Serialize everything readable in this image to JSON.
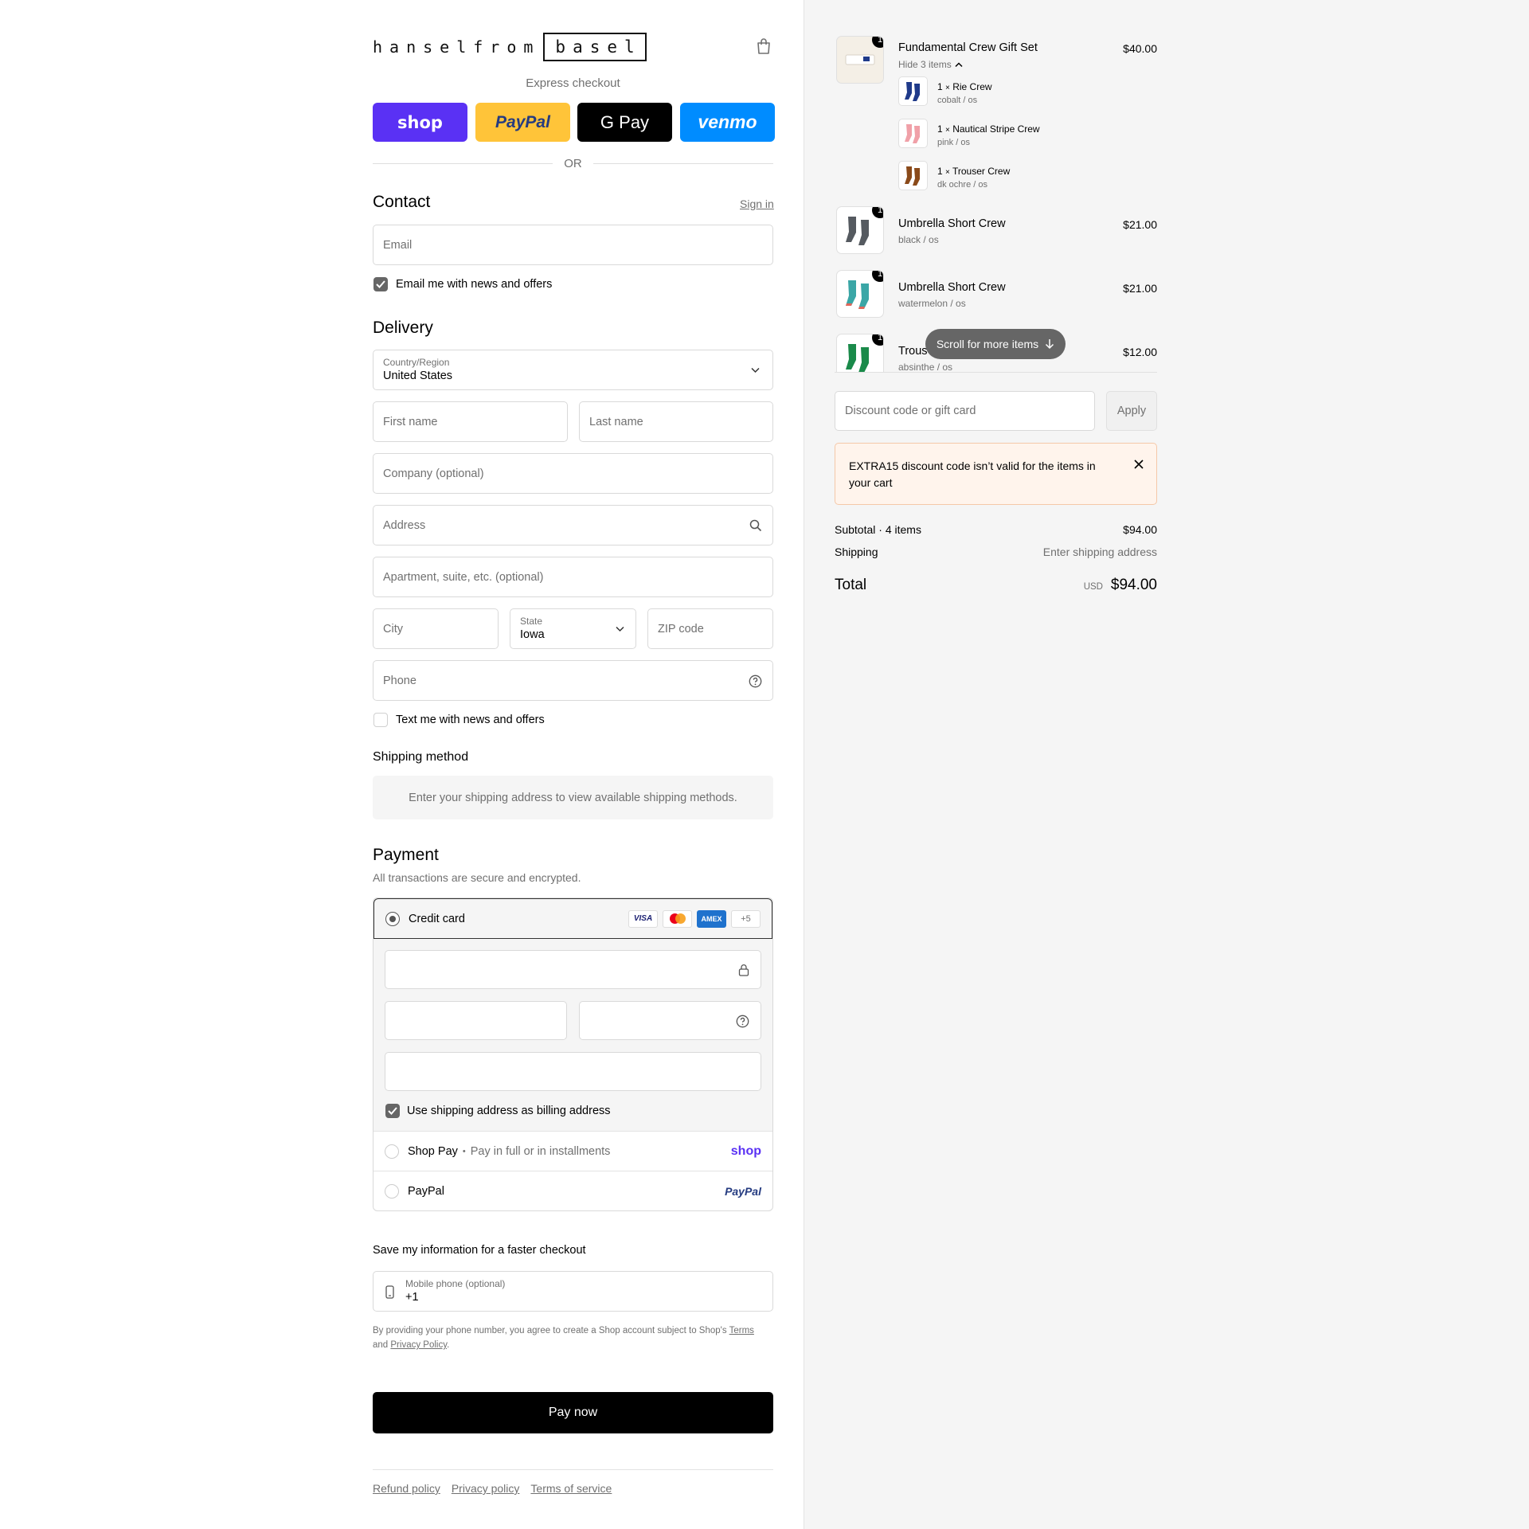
{
  "brand": {
    "word1": "hanselfrom",
    "word2": "basel"
  },
  "express": {
    "title": "Express checkout",
    "buttons": [
      {
        "label": "shop",
        "color": "#5a31f4",
        "text_color": "#ffffff"
      },
      {
        "label": "PayPal",
        "color": "#ffc439",
        "text_color": "#253b80"
      },
      {
        "label": "G Pay",
        "color": "#000000",
        "text_color": "#ffffff"
      },
      {
        "label": "venmo",
        "color": "#008cff",
        "text_color": "#ffffff"
      }
    ],
    "or": "OR"
  },
  "contact": {
    "heading": "Contact",
    "sign_in": "Sign in",
    "email_placeholder": "Email",
    "news_label": "Email me with news and offers",
    "news_checked": true
  },
  "delivery": {
    "heading": "Delivery",
    "country_label": "Country/Region",
    "country_value": "United States",
    "first_name": "First name",
    "last_name": "Last name",
    "company": "Company (optional)",
    "address": "Address",
    "apartment": "Apartment, suite, etc. (optional)",
    "city": "City",
    "state_label": "State",
    "state_value": "Iowa",
    "zip": "ZIP code",
    "phone": "Phone",
    "text_label": "Text me with news and offers",
    "text_checked": false
  },
  "shipping_method": {
    "heading": "Shipping method",
    "message": "Enter your shipping address to view available shipping methods."
  },
  "payment": {
    "heading": "Payment",
    "subtitle": "All transactions are secure and encrypted.",
    "credit_card_label": "Credit card",
    "cards": [
      "VISA",
      "MC",
      "AMEX",
      "+5"
    ],
    "billing_label": "Use shipping address as billing address",
    "billing_checked": true,
    "shop_pay_label": "Shop Pay",
    "shop_pay_sep": "•",
    "shop_pay_desc": "Pay in full or in installments",
    "shop_pay_logo": "shop",
    "paypal_label": "PayPal",
    "paypal_logo": "PayPal"
  },
  "save_info": {
    "heading": "Save my information for a faster checkout",
    "mobile_label": "Mobile phone (optional)",
    "mobile_value": "+1",
    "legal_prefix": "By providing your phone number, you agree to create a Shop account subject to Shop's",
    "terms": "Terms",
    "and": "and",
    "privacy": "Privacy Policy",
    "dot": "."
  },
  "pay_now": "Pay now",
  "footer": [
    "Refund policy",
    "Privacy policy",
    "Terms of service"
  ],
  "cart": {
    "items": [
      {
        "qty": "1",
        "name": "Fundamental Crew Gift Set",
        "price": "$40.00",
        "toggle": "Hide 3 items",
        "sub": [
          {
            "qty": "1",
            "x": "×",
            "name": "Rie Crew",
            "variant": "cobalt / os",
            "color": "#1f3a8a"
          },
          {
            "qty": "1",
            "x": "×",
            "name": "Nautical Stripe Crew",
            "variant": "pink / os",
            "color": "#f0a0a8"
          },
          {
            "qty": "1",
            "x": "×",
            "name": "Trouser Crew",
            "variant": "dk ochre / os",
            "color": "#8a4a1a"
          }
        ]
      },
      {
        "qty": "1",
        "name": "Umbrella Short Crew",
        "variant": "black / os",
        "price": "$21.00",
        "color": "#555a60"
      },
      {
        "qty": "1",
        "name": "Umbrella Short Crew",
        "variant": "watermelon / os",
        "price": "$21.00",
        "color": "#3aa6a6"
      },
      {
        "qty": "1",
        "name": "Trous",
        "variant": "absinthe / os",
        "price": "$12.00",
        "color": "#1a8a4a"
      }
    ],
    "scroll_hint": "Scroll for more items",
    "discount_placeholder": "Discount code or gift card",
    "apply": "Apply",
    "warning": "EXTRA15 discount code isn’t valid for the items in your cart",
    "subtotal_label": "Subtotal · 4 items",
    "subtotal_value": "$94.00",
    "shipping_label": "Shipping",
    "shipping_value": "Enter shipping address",
    "total_label": "Total",
    "currency": "USD",
    "total_value": "$94.00"
  }
}
